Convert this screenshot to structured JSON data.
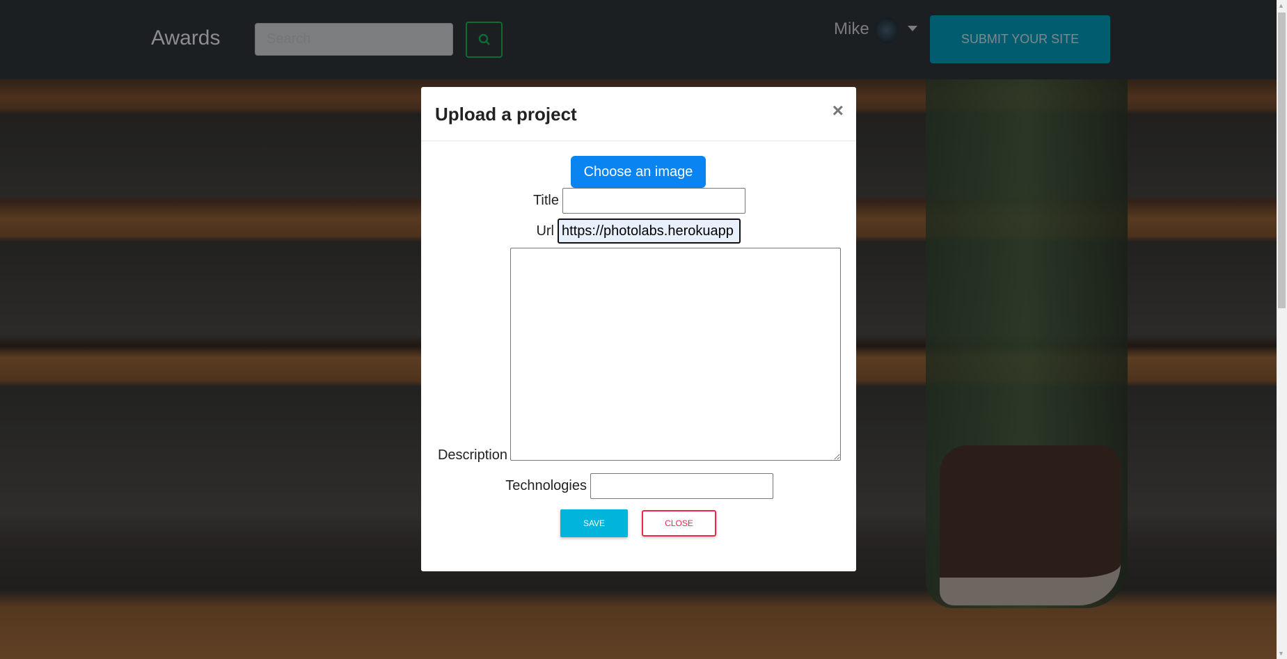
{
  "nav": {
    "brand": "Awards",
    "search_placeholder": "Search",
    "user_name": "Mike",
    "submit_label": "SUBMIT YOUR SITE",
    "accent": "#005c6e"
  },
  "modal": {
    "title": "Upload a project",
    "close_icon": "×",
    "choose_image_label": "Choose an image",
    "fields": {
      "title_label": "Title",
      "title_value": "",
      "url_label": "Url",
      "url_value": "https://photolabs.herokuapp",
      "description_label": "Description",
      "description_value": "",
      "technologies_label": "Technologies",
      "technologies_value": ""
    },
    "save_label": "SAVE",
    "close_label": "CLOSE"
  }
}
